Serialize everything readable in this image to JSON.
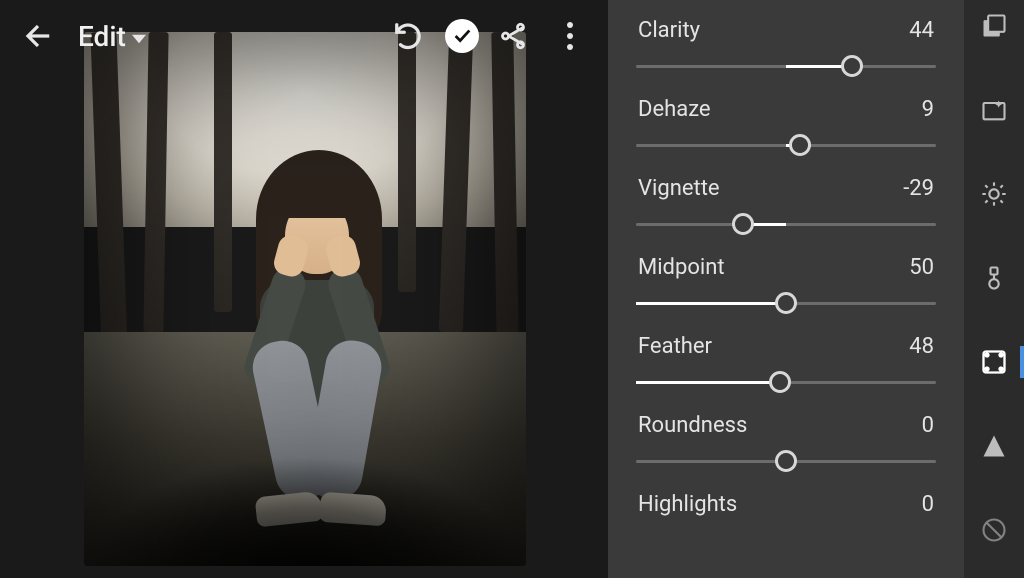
{
  "header": {
    "title": "Edit"
  },
  "sliders": [
    {
      "label": "Clarity",
      "value": 44,
      "min": -100,
      "max": 100
    },
    {
      "label": "Dehaze",
      "value": 9,
      "min": -100,
      "max": 100
    },
    {
      "label": "Vignette",
      "value": -29,
      "min": -100,
      "max": 100
    },
    {
      "label": "Midpoint",
      "value": 50,
      "min": 0,
      "max": 100
    },
    {
      "label": "Feather",
      "value": 48,
      "min": 0,
      "max": 100
    },
    {
      "label": "Roundness",
      "value": 0,
      "min": -100,
      "max": 100
    },
    {
      "label": "Highlights",
      "value": 0,
      "min": -100,
      "max": 100
    }
  ],
  "tool_strip": {
    "items": [
      {
        "name": "versions-icon"
      },
      {
        "name": "auto-icon"
      },
      {
        "name": "light-icon"
      },
      {
        "name": "color-icon"
      },
      {
        "name": "effects-icon",
        "active": true
      },
      {
        "name": "detail-icon"
      },
      {
        "name": "optics-icon"
      }
    ]
  }
}
